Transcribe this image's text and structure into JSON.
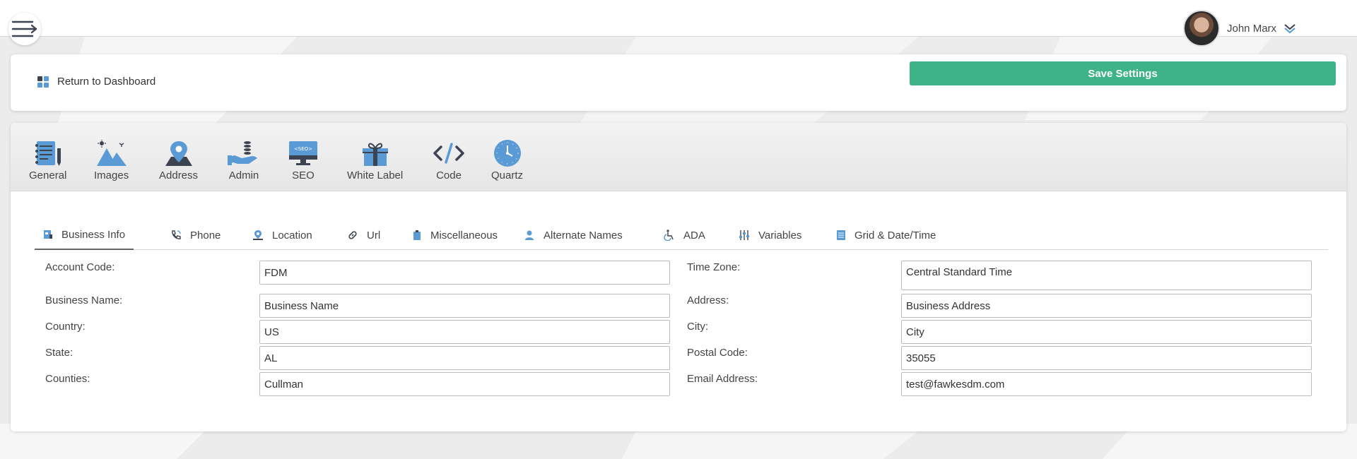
{
  "header": {
    "user_name": "John Marx"
  },
  "top_card": {
    "return_label": "Return to Dashboard",
    "save_label": "Save Settings"
  },
  "icon_bar": {
    "items": [
      {
        "label": "General",
        "icon": "notebook-icon"
      },
      {
        "label": "Images",
        "icon": "mountain-image-icon"
      },
      {
        "label": "Address",
        "icon": "map-pin-icon"
      },
      {
        "label": "Admin",
        "icon": "hand-coins-icon"
      },
      {
        "label": "SEO",
        "icon": "seo-monitor-icon"
      },
      {
        "label": "White Label",
        "icon": "gift-icon"
      },
      {
        "label": "Code",
        "icon": "code-icon"
      },
      {
        "label": "Quartz",
        "icon": "clock-icon"
      }
    ]
  },
  "tabs": [
    {
      "label": "Business Info",
      "icon": "business-card-icon",
      "active": true
    },
    {
      "label": "Phone",
      "icon": "phone-icon"
    },
    {
      "label": "Location",
      "icon": "location-pin-icon"
    },
    {
      "label": "Url",
      "icon": "link-icon"
    },
    {
      "label": "Miscellaneous",
      "icon": "clipboard-icon"
    },
    {
      "label": "Alternate Names",
      "icon": "person-icon"
    },
    {
      "label": "ADA",
      "icon": "wheelchair-icon"
    },
    {
      "label": "Variables",
      "icon": "sliders-icon"
    },
    {
      "label": "Grid & Date/Time",
      "icon": "calendar-grid-icon"
    }
  ],
  "form": {
    "account_code": {
      "label": "Account Code:",
      "value": "FDM"
    },
    "business_name": {
      "label": "Business Name:",
      "value": "Business Name"
    },
    "country": {
      "label": "Country:",
      "value": "US"
    },
    "state": {
      "label": "State:",
      "value": "AL"
    },
    "counties": {
      "label": "Counties:",
      "value": "Cullman"
    },
    "time_zone": {
      "label": "Time Zone:",
      "value": "Central Standard Time"
    },
    "address": {
      "label": "Address:",
      "value": "Business Address"
    },
    "city": {
      "label": "City:",
      "value": "City"
    },
    "postal_code": {
      "label": "Postal Code:",
      "value": "35055"
    },
    "email": {
      "label": "Email Address:",
      "value": "test@fawkesdm.com"
    }
  },
  "colors": {
    "accent_green": "#3db387",
    "icon_blue": "#5b9bd5",
    "icon_dark": "#3d4451"
  }
}
